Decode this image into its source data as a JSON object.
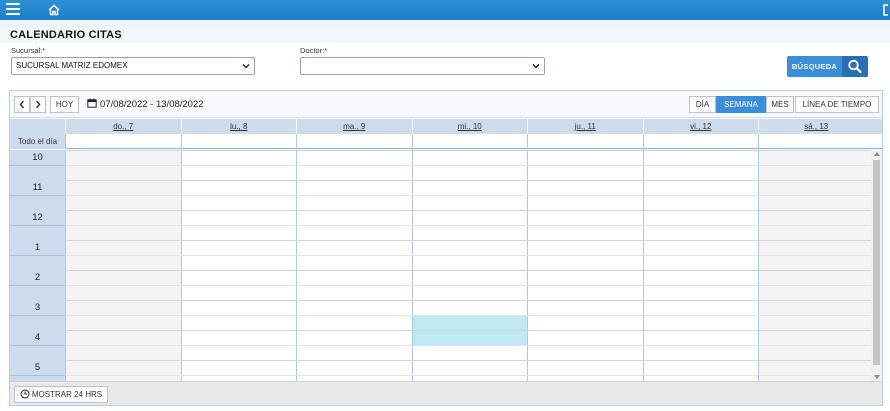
{
  "topbar": {
    "menu_icon": "hamburger-icon",
    "home_icon": "home-icon",
    "exit_icon": "exit-icon"
  },
  "page": {
    "title": "CALENDARIO CITAS"
  },
  "filters": {
    "sucursal_label": "Sucursal:",
    "sucursal_value": "SUCURSAL MATRIZ EDOMEX",
    "doctor_label": "Doctor:",
    "doctor_value": "",
    "required_mark": "*",
    "search_label": "BÚSQUEDA"
  },
  "calendar": {
    "today_label": "HOY",
    "date_range": "07/08/2022 - 13/08/2022",
    "views": [
      "DÍA",
      "SEMANA",
      "MES",
      "LÍNEA DE TIEMPO"
    ],
    "active_view": "SEMANA",
    "days": [
      "do., 7",
      "lu., 8",
      "ma., 9",
      "mi., 10",
      "ju., 11",
      "vi., 12",
      "sá., 13"
    ],
    "all_day_label": "Todo el día",
    "hours": [
      "10",
      "11",
      "12",
      "1",
      "2",
      "3",
      "4",
      "5"
    ],
    "show24_label": "MOSTRAR 24 HRS",
    "highlight": {
      "day": "mi., 10",
      "start": "3:30",
      "end": "4:30"
    },
    "accent_color": "#3b8fd9",
    "highlight_color": "#bde9f3"
  }
}
